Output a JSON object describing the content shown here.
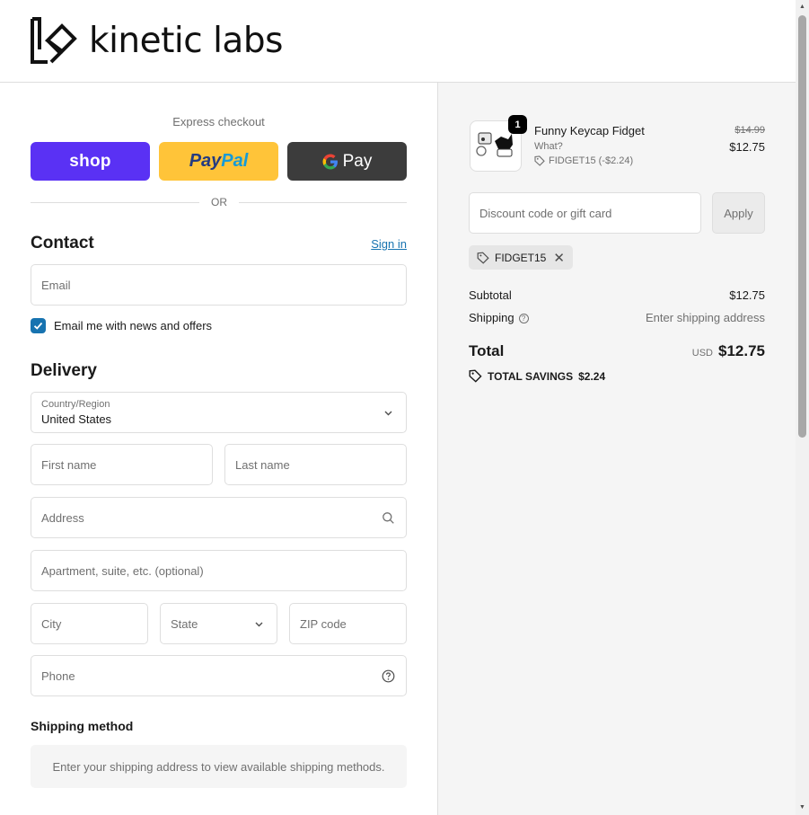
{
  "brand": {
    "name": "kinetic labs"
  },
  "express": {
    "title": "Express checkout",
    "shop_label": "shop",
    "paypal_label_1": "Pay",
    "paypal_label_2": "Pal",
    "gpay_label": "Pay",
    "or_text": "OR"
  },
  "contact": {
    "title": "Contact",
    "sign_in": "Sign in",
    "email_placeholder": "Email",
    "newsletter_label": "Email me with news and offers",
    "newsletter_checked": true
  },
  "delivery": {
    "title": "Delivery",
    "country_label": "Country/Region",
    "country_value": "United States",
    "first_name": "First name",
    "last_name": "Last name",
    "address": "Address",
    "apartment": "Apartment, suite, etc. (optional)",
    "city": "City",
    "state": "State",
    "zip": "ZIP code",
    "phone": "Phone"
  },
  "shipping_method": {
    "title": "Shipping method",
    "notice": "Enter your shipping address to view available shipping methods."
  },
  "order": {
    "product": {
      "name": "Funny Keycap Fidget",
      "variant": "What?",
      "discount": "FIDGET15 (-$2.24)",
      "quantity": "1",
      "old_price": "$14.99",
      "new_price": "$12.75"
    },
    "discount_placeholder": "Discount code or gift card",
    "apply_label": "Apply",
    "applied_code": "FIDGET15",
    "subtotal_label": "Subtotal",
    "subtotal_value": "$12.75",
    "shipping_label": "Shipping",
    "shipping_value": "Enter shipping address",
    "total_label": "Total",
    "currency": "USD",
    "total_value": "$12.75",
    "savings_label": "TOTAL SAVINGS",
    "savings_value": "$2.24"
  },
  "colors": {
    "shop": "#5a31f4",
    "paypal": "#ffc439",
    "gpay": "#3c3c3c",
    "link": "#1773b0",
    "checkbox": "#1773b0"
  }
}
